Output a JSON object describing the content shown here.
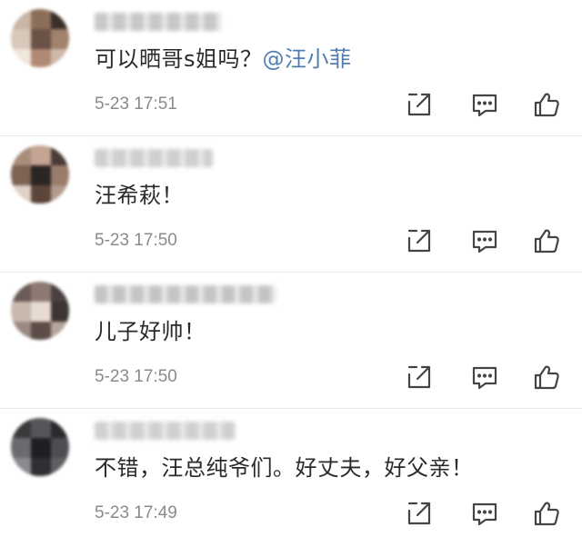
{
  "comments": [
    {
      "avatar_colors": [
        "#c9b6a6",
        "#8c6f5b",
        "#3b2f2a",
        "#d8c8ba",
        "#6b5146",
        "#a0826d",
        "#f1e6dc",
        "#b08a74",
        "#d0b9a8"
      ],
      "username_color": "#c8c8c8",
      "text": "可以晒哥s姐吗？",
      "mention": "@汪小菲",
      "time": "5-23 17:51"
    },
    {
      "avatar_colors": [
        "#a88c7c",
        "#c4a493",
        "#4b3b35",
        "#7e6254",
        "#2b2524",
        "#9a7c6c",
        "#e0d1c6",
        "#5c463c",
        "#b49a8c"
      ],
      "username_color": "#cfcfcf",
      "text": "汪希萩！",
      "mention": "",
      "time": "5-23 17:50"
    },
    {
      "avatar_colors": [
        "#6b5b58",
        "#8e7a72",
        "#4a4040",
        "#c9b8ae",
        "#e7dbd3",
        "#3d3434",
        "#9c8a82",
        "#5c4d49",
        "#b6a59c"
      ],
      "username_color": "#c4c4c4",
      "text": "儿子好帅！",
      "mention": "",
      "time": "5-23 17:50"
    },
    {
      "avatar_colors": [
        "#3a3a3c",
        "#55565a",
        "#2a2a2c",
        "#6a6b70",
        "#1f1f21",
        "#4d4e52",
        "#8a8b90",
        "#303033",
        "#5f6064"
      ],
      "username_color": "#d0d0d0",
      "text": "不错，汪总纯爷们。好丈夫，好父亲！",
      "mention": "",
      "time": "5-23 17:49"
    }
  ],
  "icons": {
    "share": "share-icon",
    "reply": "comment-icon",
    "like": "thumbs-up-icon"
  },
  "colors": {
    "text": "#2a2a2a",
    "meta": "#8a8a8a",
    "mention": "#507daf",
    "icon": "#444444",
    "divider": "#e6e6e6"
  }
}
